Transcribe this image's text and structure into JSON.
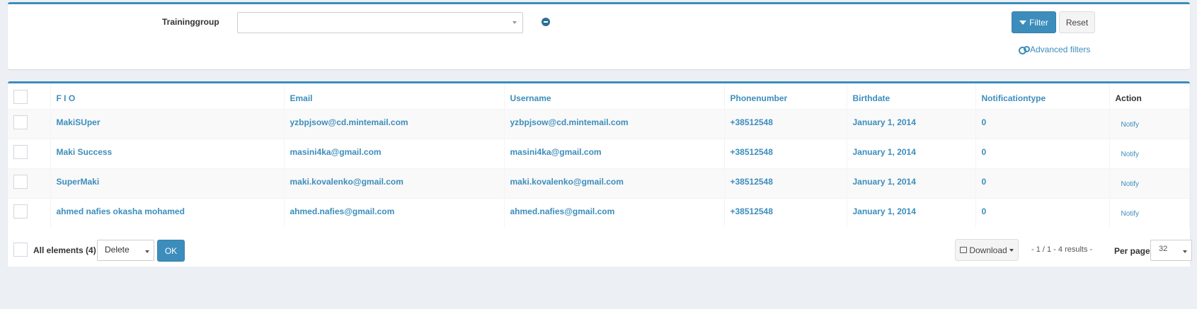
{
  "filters": {
    "traininggroup_label": "Traininggroup",
    "traininggroup_value": "",
    "filter_label": "Filter",
    "reset_label": "Reset",
    "advanced_label": "Advanced filters"
  },
  "table": {
    "columns": [
      "F I O",
      "Email",
      "Username",
      "Phonenumber",
      "Birthdate",
      "Notificationtype",
      "Action"
    ],
    "rows": [
      {
        "fio": "MakiSUper",
        "email": "yzbpjsow@cd.mintemail.com",
        "username": "yzbpjsow@cd.mintemail.com",
        "phone": "+38512548",
        "birthdate": "January 1, 2014",
        "notificationtype": "0",
        "action": "Notify"
      },
      {
        "fio": "Maki Success",
        "email": "masini4ka@gmail.com",
        "username": "masini4ka@gmail.com",
        "phone": "+38512548",
        "birthdate": "January 1, 2014",
        "notificationtype": "0",
        "action": "Notify"
      },
      {
        "fio": "SuperMaki",
        "email": "maki.kovalenko@gmail.com",
        "username": "maki.kovalenko@gmail.com",
        "phone": "+38512548",
        "birthdate": "January 1, 2014",
        "notificationtype": "0",
        "action": "Notify"
      },
      {
        "fio": "ahmed nafies okasha mohamed",
        "email": "ahmed.nafies@gmail.com",
        "username": "ahmed.nafies@gmail.com",
        "phone": "+38512548",
        "birthdate": "January 1, 2014",
        "notificationtype": "0",
        "action": "Notify"
      }
    ]
  },
  "footer": {
    "all_elements": "All elements (4)",
    "batch_action": "Delete",
    "ok_label": "OK",
    "download_label": "Download",
    "pager": "- 1 / 1 - 4 results -",
    "per_page_label": "Per page",
    "per_page_value": "32"
  },
  "colors": {
    "accent": "#3c8dbc",
    "background": "#ecf0f5"
  }
}
